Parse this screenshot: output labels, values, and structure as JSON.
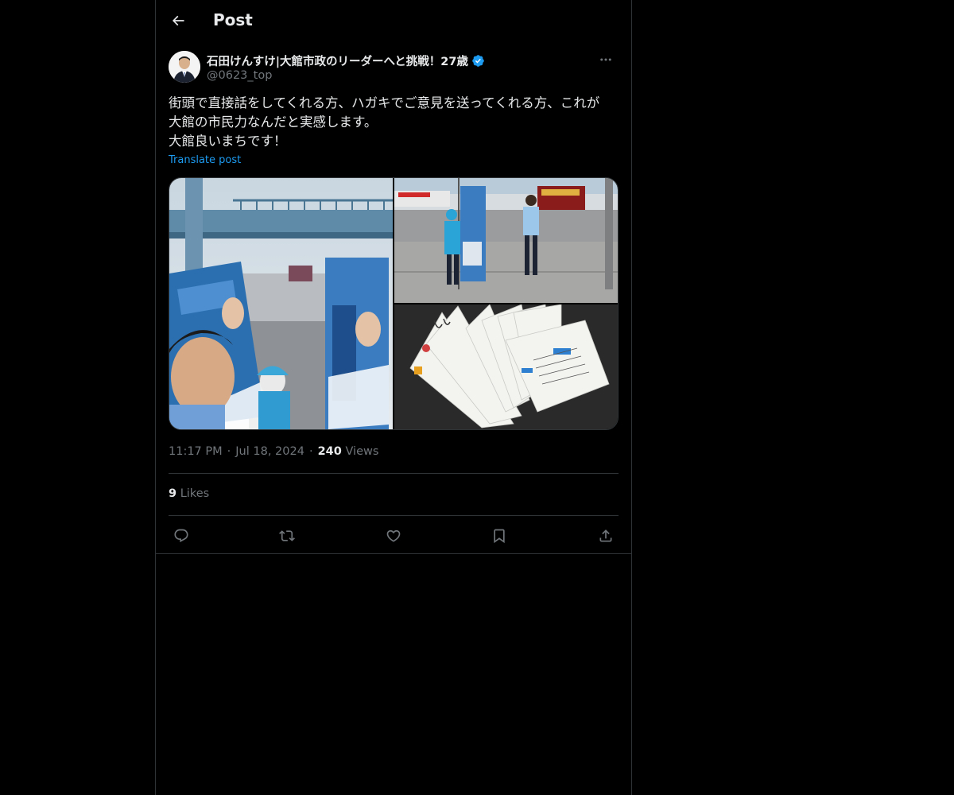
{
  "header": {
    "title": "Post",
    "back_icon": "arrow-left-icon"
  },
  "post": {
    "author": {
      "display_name": "石田けんすけ|大館市政のリーダーへと挑戦！27歳",
      "handle": "@0623_top",
      "verified": true,
      "verified_color": "#1d9bf0"
    },
    "text_lines": [
      "街頭で直接話をしてくれる方、ハガキでご意見を送ってくれる方、これが",
      "大館の市民力なんだと実感します。",
      "大館良いまちです！"
    ],
    "translate_label": "Translate post",
    "media": [
      {
        "description_icon": "photo-selfie-campaign-icon"
      },
      {
        "description_icon": "photo-street-campaign-icon"
      },
      {
        "description_icon": "photo-postcards-icon"
      }
    ],
    "time": "11:17 PM",
    "date": "Jul 18, 2024",
    "views_count": "240",
    "views_label": "Views",
    "likes_count": "9",
    "likes_label": "Likes"
  },
  "actions": [
    {
      "name": "reply-icon"
    },
    {
      "name": "repost-icon"
    },
    {
      "name": "like-icon"
    },
    {
      "name": "bookmark-icon"
    },
    {
      "name": "share-icon"
    }
  ],
  "colors": {
    "background": "#000000",
    "text": "#e7e9ea",
    "secondary_text": "#71767b",
    "accent": "#1d9bf0",
    "border": "#2f3336"
  }
}
